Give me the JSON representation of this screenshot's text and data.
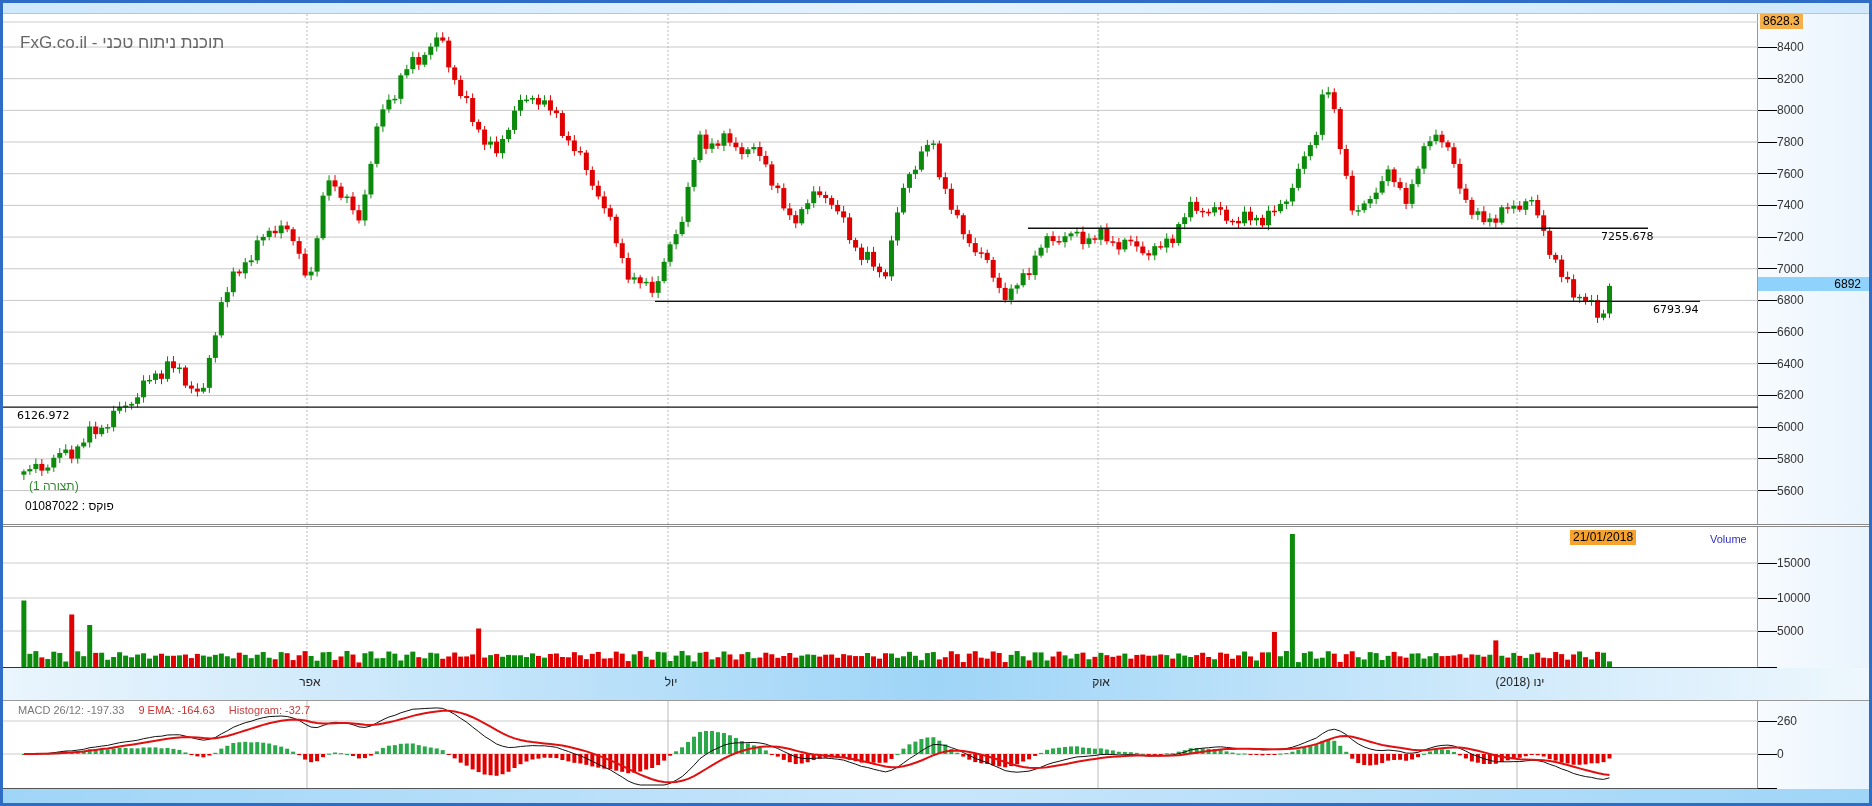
{
  "header": {
    "title": "FxG.co.il - תוכנת ניתוח טכני"
  },
  "price_panel": {
    "high_label": "8628.3",
    "last_price": "6892",
    "ticks": [
      "8400",
      "8200",
      "8000",
      "7800",
      "7600",
      "7400",
      "7200",
      "7000",
      "6800",
      "6600",
      "6400",
      "6200",
      "6000",
      "5800",
      "5600"
    ],
    "levels": [
      {
        "label": "7255.678"
      },
      {
        "label": "6793.94"
      },
      {
        "label": "6126.972"
      }
    ],
    "layout_label": "(תצורה 1)",
    "symbol_label": "פוקס : 01087022"
  },
  "volume_panel": {
    "date_label": "21/01/2018",
    "title": "Volume",
    "ticks": [
      "15000",
      "10000",
      "5000"
    ]
  },
  "time_axis": {
    "labels": [
      "ינו (2018)",
      "אוק",
      "יול",
      "אפר"
    ]
  },
  "macd_panel": {
    "macd": "MACD 26/12: -197.33",
    "ema": "9 EMA: -164.63",
    "histogram": "Histogram: -32.7",
    "ticks": [
      "260",
      "0"
    ]
  }
}
